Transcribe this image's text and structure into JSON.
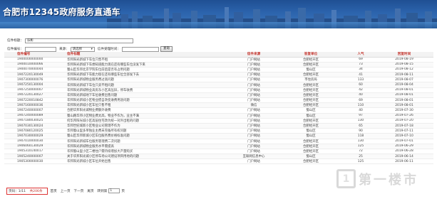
{
  "header": {
    "title": "合肥市12345政府服务直通车"
  },
  "search": {
    "title_label": "信件标题：",
    "title_value": "乐彰",
    "number_label": "信件编号：",
    "source_label": "来源：",
    "source_select": "请选择",
    "date_label": "信件受理时间：",
    "query_button": "查询"
  },
  "table": {
    "headers": [
      "信件编号",
      "信件标题",
      "信件来源",
      "答复单位",
      "人气",
      "回复时间"
    ],
    "rows": [
      [
        "1900000000000",
        "华邦阳光新城下车位只售不租",
        "门户网站",
        "合肥经开区",
        "69",
        "2019-08-19"
      ],
      [
        "1900010000066",
        "华邦阳光新城下车想知道能力现在还有哪些车位没发下来",
        "门户网站",
        "合肥经开区",
        "73",
        "2019-08-15"
      ],
      [
        "1900070000044",
        "蜀山区华邦北京学院车位前后是否有占用问题",
        "门户网站",
        "蜀山区",
        "34",
        "2019-08-12"
      ],
      [
        "1907220130049",
        "华邦阳光新城下车能力现在还有哪些车位全部发下去",
        "门户网站",
        "合肥经开区",
        "41",
        "2019-08-11"
      ],
      [
        "1907300000076",
        "华邦阳光新城物业服务费过高问题",
        "门户网站",
        "市住房局",
        "133",
        "2019-08-07"
      ],
      [
        "1907250130004",
        "华邦阳光新城下车位只卖不租问题",
        "门户网站",
        "合肥经开区",
        "60",
        "2019-08-04"
      ],
      [
        "1907250000007",
        "华邦阳光新城物业高房东小区高压旧，停车收费",
        "门户网站",
        "合肥经开区",
        "42",
        "2019-08-01"
      ],
      [
        "1907220130027",
        "华邦阳光新城地下车位收费出售问题",
        "门户网站",
        "合肥经开区",
        "40",
        "2019-08-01"
      ],
      [
        "1907220010842",
        "华邦阳光新城小区物业擅自改变收费用途问题",
        "门户网站",
        "合肥经开区",
        "69",
        "2019-08-01"
      ],
      [
        "1907160000036",
        "华邦阳光新城小区车位只售不租",
        "微信",
        "合肥经开区",
        "110",
        "2019-08-01"
      ],
      [
        "1907240000007",
        "合肥华邦阳光城物业费额外收费",
        "门户网站",
        "蜀山区",
        "40",
        "2019-07-30"
      ],
      [
        "1907240000089",
        "蜀山路华邦小区物业费太高，物业不作为，业主不满",
        "门户网站",
        "蜀山区",
        "97",
        "2019-07-26"
      ],
      [
        "1907180030025",
        "何华邦阳光城小区高层住宅改为统一对外出租的问题",
        "门户网站",
        "合肥经开区",
        "130",
        "2019-07-20"
      ],
      [
        "1907030130024",
        "华邦世纪城新小区物业公司管理不作为",
        "门户网站",
        "合肥经开区",
        "65",
        "2019-07-18"
      ],
      [
        "1907080120025",
        "华邦蜀山里多单独业主费未完备所有权问题",
        "门户网站",
        "蜀山区",
        "90",
        "2019-07-11"
      ],
      [
        "1907030000029",
        "蜀山区华邦新城小区车位服务费价格标准问题",
        "门户网站",
        "蜀山区",
        "118",
        "2019-07-10"
      ],
      [
        "1907010000030",
        "华邦阳光新城车位服务管理费二次问题",
        "门户网站",
        "合肥经开区",
        "130",
        "2019-07-01"
      ],
      [
        "1906060130029",
        "华邦阳光新城物业服务水平需提高",
        "门户网站",
        "合肥经开区",
        "125",
        "2019-06-29"
      ],
      [
        "1905310140017",
        "华邦蜀山里小区二楼住户需持续增加大产量购买",
        "门户网站",
        "合肥经开区",
        "72",
        "2019-06-28"
      ],
      [
        "1905240000007",
        "关于华邦阳光城小区停车场公司建设项目用地的问题",
        "互联网信息中心",
        "蜀山区",
        "25",
        "2019-06-14"
      ],
      [
        "1905300000030",
        "华邦阳光新城小区车位开始出售",
        "门户网站",
        "合肥经开区",
        "125",
        "2019-06-11"
      ]
    ]
  },
  "pager": {
    "page_info": "页码：1/11",
    "total": "共206条",
    "first": "首页",
    "prev": "上一页",
    "next": "下一页",
    "last": "尾页",
    "jump_label": "转到第",
    "jump_value": "1",
    "page_unit": "页"
  },
  "watermark": {
    "logo_text": "1",
    "text": "第一楼市"
  }
}
